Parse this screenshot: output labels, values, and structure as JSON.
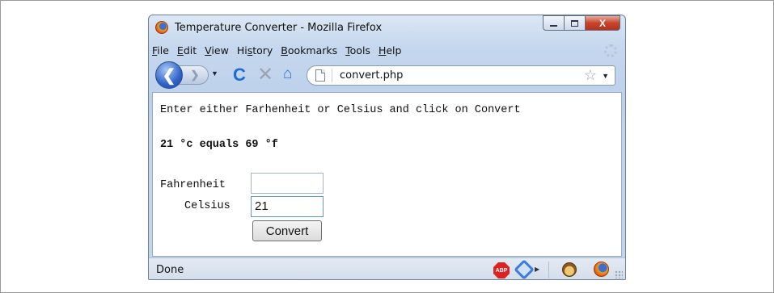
{
  "window": {
    "title": "Temperature Converter - Mozilla Firefox",
    "caption_buttons": {
      "minimize": "minimize-icon",
      "maximize": "maximize-icon",
      "close": "X"
    }
  },
  "menubar": {
    "items": [
      {
        "underline": "F",
        "rest": "ile"
      },
      {
        "underline": "E",
        "rest": "dit"
      },
      {
        "underline": "V",
        "rest": "iew"
      },
      {
        "pre": "Hi",
        "underline": "s",
        "rest": "tory"
      },
      {
        "underline": "B",
        "rest": "ookmarks"
      },
      {
        "underline": "T",
        "rest": "ools"
      },
      {
        "underline": "H",
        "rest": "elp"
      }
    ]
  },
  "toolbar": {
    "back_glyph": "❮",
    "forward_glyph": "❯",
    "dropdown_glyph": "▼",
    "reload_glyph": "C",
    "stop_glyph": "✕",
    "home_glyph": "⌂",
    "url": "convert.php",
    "bookmark_glyph": "☆"
  },
  "page": {
    "instruction": "Enter either Farhenheit or Celsius and click on Convert",
    "result": "21 °c equals 69 °f",
    "fahrenheit_label": "Fahrenheit",
    "fahrenheit_value": "",
    "celsius_label": "Celsius",
    "celsius_value": "21",
    "convert_label": "Convert"
  },
  "statusbar": {
    "text": "Done",
    "abp_label": "ABP",
    "arrow_glyph": "▶"
  }
}
